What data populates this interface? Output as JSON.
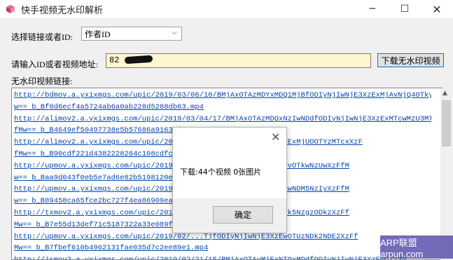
{
  "window": {
    "title": "快手视频无水印解析",
    "icon": "cube-icon",
    "minimize_glyph": "─",
    "maximize_glyph": "☐",
    "close_glyph": "✕"
  },
  "form": {
    "select_label": "选择链接或者ID:",
    "select_value": "作者ID",
    "input_label": "请输入ID或者视频地址:",
    "input_value": "82",
    "download_button": "下载无水印视频",
    "list_label": "无水印视频链接:"
  },
  "list": {
    "lines": [
      "http://bdmov.a.yxixmgs.com/upic/2019/03/06/10/BMjAxOTAzMDYxMDQ1MjBfODIyNjIwNjE3XzExMjAvNjQ4OTkyXzFfM",
      "w== b_Bf0d6ecf4a5724ab6a0ab228d5288db63.mp4",
      "http://alimov2.a.yxixmgs.com/upic/2019/03/04/17/BMjAxOTAzMDQxNzIwNDdfODIyNjIwNjE3XzExMTcwMzU3MTkwXzF",
      "fMw== b_B4649ef50497738e5b57686a91639d...mp4",
      "http://alimov2.a.yxixmgs.com/upic/2019/03/...DRfODIyNjIwNjE3XzExMjUOOTYzMTcxXzF",
      "fMw== b_B90cdf221d4382228264c108cdfcd3...",
      "http://upmov.a.yxixmgs.com/upic/2019/03/...ODIyNjIwNjE3XzExMTUvOTkwNzUwXzFfM",
      "w== b_Baa9d043f0eb5e7ad6e82b5198120ed...",
      "http://upmov.a.yxixmgs.com/upic/2019/02/...ODIyNjIwNjE3XzExMDgwNDM5NzIyXzFfM",
      "w== b_B89458ca65fce2bc727f4ea86909ea9...",
      "http://txmov2.a.yxixmgs.com/upic/2019/03/...ODIyNjIwNjE3XzEwOTk5NzgzODkzXzFf",
      "Mw== b_B7e55d13def71c5187322a33e089fa...",
      "http://upmov.a.yxixmgs.com/upic/2019/02/...TjfODIyNjIwNjE3XzEwOTUzNDk2NDE2XzFf",
      "Mw== b_B7fbef610b4962131fae035d7c2ee89e1.mp4",
      "http://jsmov2.a.yxixmgs.com/upic/2019/02/21/15/BMjAxOTAyMjExNTQxMDdfODIyNjIwNjE3XzEwOTI3N..."
    ]
  },
  "dialog": {
    "close_glyph": "✕",
    "message": "下载:44个视频  0张图片",
    "ok_button": "确定"
  },
  "watermark": {
    "text": "ARP联盟 arpun.com"
  }
}
